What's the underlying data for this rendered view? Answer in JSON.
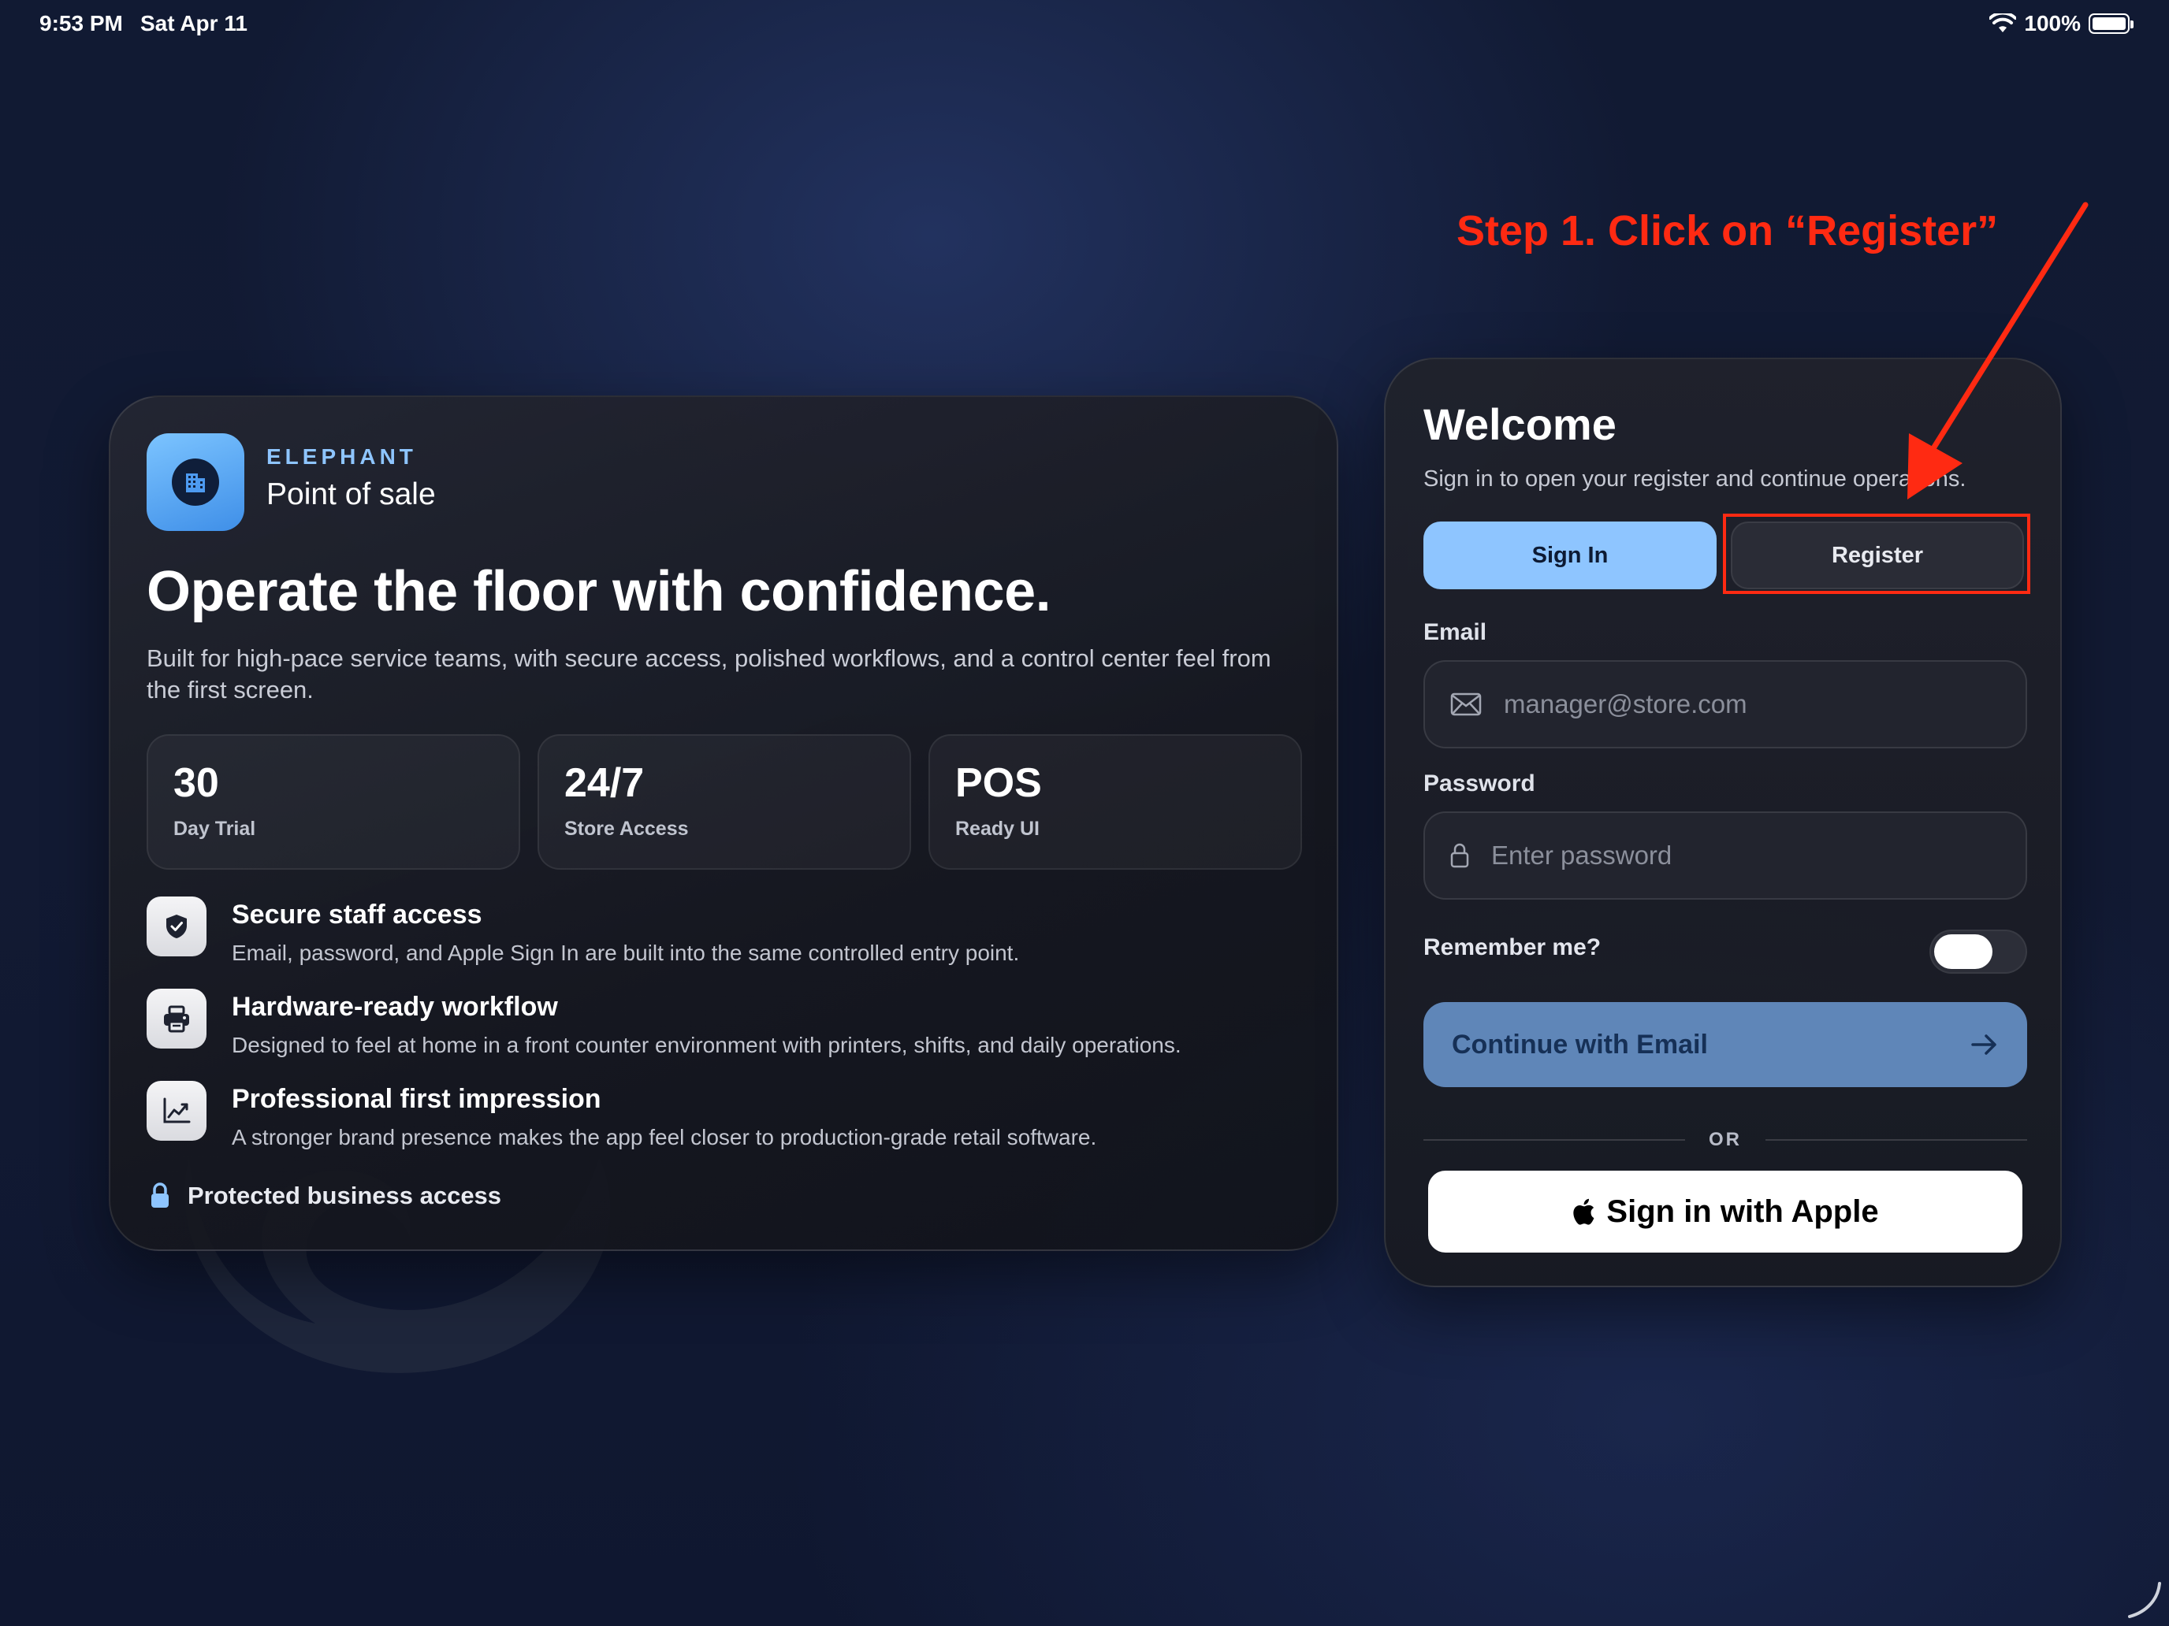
{
  "status_bar": {
    "time": "9:53 PM",
    "date": "Sat Apr 11",
    "battery": "100%",
    "icons": [
      "wifi-icon",
      "battery-icon"
    ]
  },
  "hero": {
    "brand_name": "ELEPHANT",
    "brand_sub": "Point of sale",
    "title": "Operate the floor with confidence.",
    "description": "Built for high-pace service teams, with secure access, polished workflows, and a control center feel from the first screen.",
    "stats": [
      {
        "value": "30",
        "label": "Day Trial"
      },
      {
        "value": "24/7",
        "label": "Store Access"
      },
      {
        "value": "POS",
        "label": "Ready UI"
      }
    ],
    "features": [
      {
        "icon": "shield-check-icon",
        "title": "Secure staff access",
        "desc": "Email, password, and Apple Sign In are built into the same controlled entry point."
      },
      {
        "icon": "printer-icon",
        "title": "Hardware-ready workflow",
        "desc": "Designed to feel at home in a front counter environment with printers, shifts, and daily operations."
      },
      {
        "icon": "chart-trend-icon",
        "title": "Professional first impression",
        "desc": "A stronger brand presence makes the app feel closer to production-grade retail software."
      }
    ],
    "protected_label": "Protected business access"
  },
  "auth": {
    "title": "Welcome",
    "subtitle": "Sign in to open your register and continue operations.",
    "tabs": {
      "sign_in": "Sign In",
      "register": "Register"
    },
    "email": {
      "label": "Email",
      "placeholder": "manager@store.com",
      "value": ""
    },
    "password": {
      "label": "Password",
      "placeholder": "Enter password",
      "value": ""
    },
    "remember_label": "Remember me?",
    "remember_on": false,
    "continue_label": "Continue with Email",
    "divider_label": "OR",
    "apple_label": "Sign in with Apple"
  },
  "annotation": {
    "text": "Step 1. Click on “Register”",
    "color": "#ff2a12"
  },
  "colors": {
    "accent": "#8ec5ff",
    "continue_bg": "#5f86b8",
    "brand_icon": "#3f8fe8"
  }
}
